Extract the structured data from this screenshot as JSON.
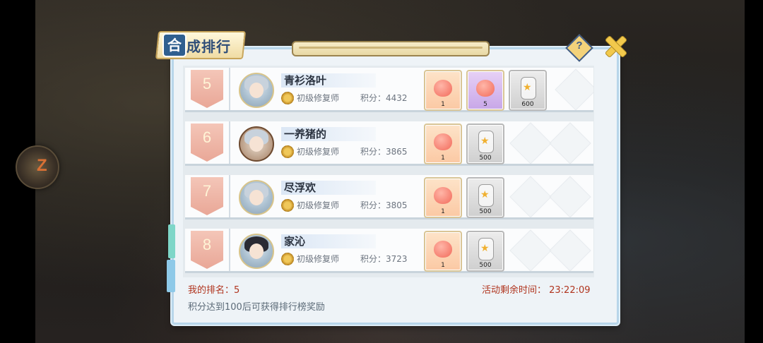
{
  "header": {
    "title_boxed_char": "合",
    "title_rest": "成排行",
    "help_icon": "question-diamond-icon",
    "close_icon": "close-x-icon"
  },
  "rows": [
    {
      "rank": "5",
      "name": "青衫洛叶",
      "title": "初级修复师",
      "score": "积分：4432",
      "rewards": [
        {
          "kind": "peach-blob",
          "count": "1"
        },
        {
          "kind": "purple-blob",
          "count": "5"
        },
        {
          "kind": "star-jar",
          "count": "600"
        }
      ]
    },
    {
      "rank": "6",
      "name": "一养猪的",
      "title": "初级修复师",
      "score": "积分：3865",
      "rewards": [
        {
          "kind": "peach-blob",
          "count": "1"
        },
        {
          "kind": "star-jar",
          "count": "500"
        }
      ]
    },
    {
      "rank": "7",
      "name": "尽浮欢",
      "title": "初级修复师",
      "score": "积分：3805",
      "rewards": [
        {
          "kind": "peach-blob",
          "count": "1"
        },
        {
          "kind": "star-jar",
          "count": "500"
        }
      ]
    },
    {
      "rank": "8",
      "name": "家沁",
      "title": "初级修复师",
      "score": "积分：3723",
      "rewards": [
        {
          "kind": "peach-blob",
          "count": "1"
        },
        {
          "kind": "star-jar",
          "count": "500"
        }
      ]
    }
  ],
  "footer": {
    "my_rank": "我的排名：5",
    "time_left": "活动剩余时间：  23:22:09",
    "hint": "积分达到100后可获得排行榜奖励"
  },
  "colors": {
    "accent_red": "#b0341e",
    "rank_badge": "#e9a797",
    "panel_border": "#b8d6ea"
  }
}
